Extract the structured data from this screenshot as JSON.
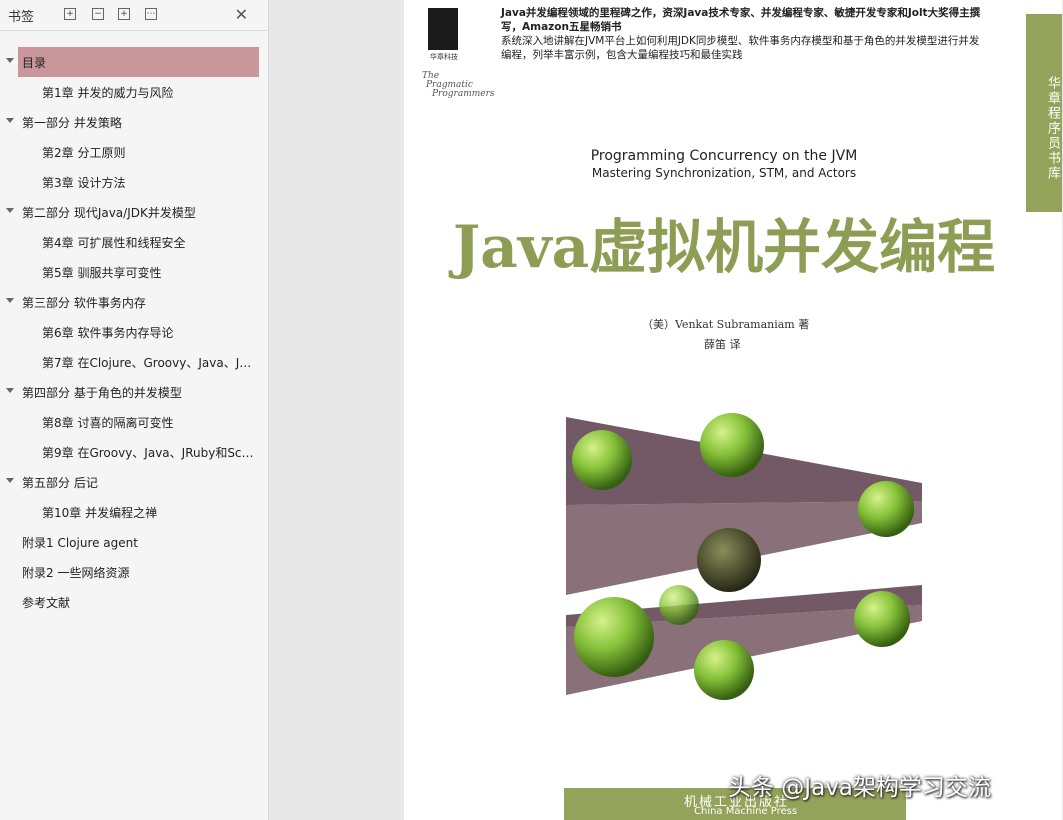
{
  "sidebar": {
    "title": "书签",
    "toolbar_icons": [
      "expand-all-icon",
      "collapse-all-icon",
      "add-bookmark-icon",
      "bookmark-options-icon"
    ],
    "close_icon": "✕",
    "items": [
      {
        "label": "目录",
        "level": 1,
        "expandable": true,
        "selected": true
      },
      {
        "label": "第1章 并发的威力与风险",
        "level": 2
      },
      {
        "label": "第一部分 并发策略",
        "level": 1,
        "expandable": true
      },
      {
        "label": "第2章 分工原则",
        "level": 2
      },
      {
        "label": "第3章 设计方法",
        "level": 2
      },
      {
        "label": "第二部分 现代Java/JDK并发模型",
        "level": 1,
        "expandable": true
      },
      {
        "label": "第4章 可扩展性和线程安全",
        "level": 2
      },
      {
        "label": "第5章 驯服共享可变性",
        "level": 2
      },
      {
        "label": "第三部分 软件事务内存",
        "level": 1,
        "expandable": true
      },
      {
        "label": "第6章 软件事务内存导论",
        "level": 2
      },
      {
        "label": "第7章 在Clojure、Groovy、Java、JR...",
        "level": 2
      },
      {
        "label": "第四部分 基于角色的并发模型",
        "level": 1,
        "expandable": true
      },
      {
        "label": "第8章 讨喜的隔离可变性",
        "level": 2
      },
      {
        "label": "第9章 在Groovy、Java、JRuby和Sca...",
        "level": 2
      },
      {
        "label": "第五部分 后记",
        "level": 1,
        "expandable": true
      },
      {
        "label": "第10章 并发编程之禅",
        "level": 2
      },
      {
        "label": "附录1 Clojure agent",
        "level": 1
      },
      {
        "label": "附录2 一些网络资源",
        "level": 1
      },
      {
        "label": "参考文献",
        "level": 1
      }
    ]
  },
  "page": {
    "logo_text": "华章科技",
    "pragmatic": [
      "The",
      "Pragmatic",
      "Programmers"
    ],
    "blurb_bold": "Java并发编程领域的里程碑之作，资深Java技术专家、并发编程专家、敏捷开发专家和Jolt大奖得主撰写，Amazon五星畅销书",
    "blurb_text": "系统深入地讲解在JVM平台上如何利用JDK同步模型、软件事务内存模型和基于角色的并发模型进行并发编程，列举丰富示例，包含大量编程技巧和最佳实践",
    "series_label": "华章程序员书库",
    "en_title": "Programming Concurrency on the JVM",
    "en_subtitle": "Mastering Synchronization, STM, and Actors",
    "cn_title": "Java虚拟机并发编程",
    "author": "（美）Venkat Subramaniam 著",
    "translator": "薛笛  译",
    "publisher_cn": "机械工业出版社",
    "publisher_en": "China Machine Press"
  },
  "watermark": "头条 @Java架构学习交流",
  "colors": {
    "accent_green": "#8d9d54",
    "selected_bg": "#c9969c"
  }
}
